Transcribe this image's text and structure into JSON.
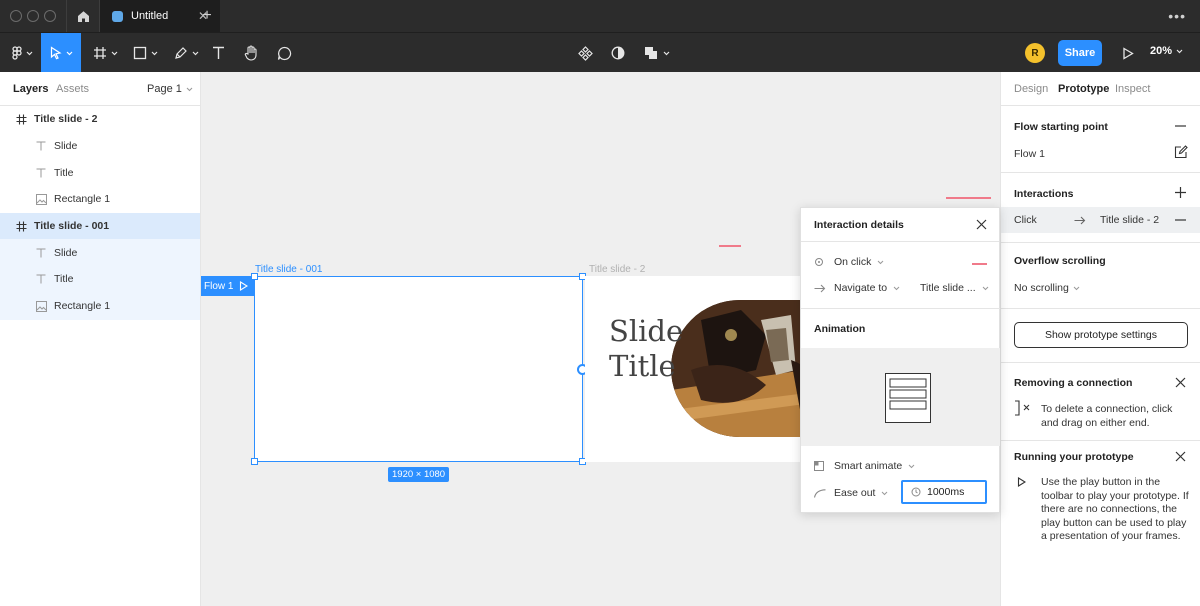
{
  "window": {
    "tab_title": "Untitled"
  },
  "toolbar": {
    "avatar_initial": "R",
    "share_label": "Share",
    "zoom_level": "20%"
  },
  "left_panel": {
    "tabs": [
      "Layers",
      "Assets"
    ],
    "page_selector": "Page 1",
    "layers": [
      {
        "name": "Title slide - 2",
        "type": "frame"
      },
      {
        "name": "Slide",
        "type": "text"
      },
      {
        "name": "Title",
        "type": "text"
      },
      {
        "name": "Rectangle 1",
        "type": "image"
      },
      {
        "name": "Title slide - 001",
        "type": "frame"
      },
      {
        "name": "Slide",
        "type": "text"
      },
      {
        "name": "Title",
        "type": "text"
      },
      {
        "name": "Rectangle 1",
        "type": "image"
      }
    ]
  },
  "canvas": {
    "frame1_label": "Title slide - 001",
    "frame2_label": "Title slide - 2",
    "flow_tag": "Flow 1",
    "size_badge": "1920 × 1080",
    "slide_text_line1": "Slide",
    "slide_text_line2": "Title"
  },
  "interaction_details": {
    "title": "Interaction details",
    "trigger": "On click",
    "action": "Navigate to",
    "destination": "Title slide ...",
    "animation_heading": "Animation",
    "animation_type": "Smart animate",
    "easing": "Ease out",
    "duration": "1000ms"
  },
  "right_panel": {
    "tabs": [
      "Design",
      "Prototype",
      "Inspect"
    ],
    "flow_start_title": "Flow starting point",
    "flow_name": "Flow 1",
    "interactions_title": "Interactions",
    "interaction_trigger": "Click",
    "interaction_target": "Title slide - 2",
    "overflow_title": "Overflow scrolling",
    "overflow_value": "No scrolling",
    "prototype_settings_label": "Show prototype settings",
    "removing_title": "Removing a connection",
    "removing_text": "To delete a connection, click and drag on either end.",
    "running_title": "Running your prototype",
    "running_text": "Use the play button in the toolbar to play your prototype. If there are no connections, the play button can be used to play a presentation of your frames."
  },
  "colors": {
    "accent": "#2c8fff",
    "chrome_dark": "#2c2c2c",
    "avatar": "#f4c12c",
    "canvas_bg": "#efefef"
  }
}
